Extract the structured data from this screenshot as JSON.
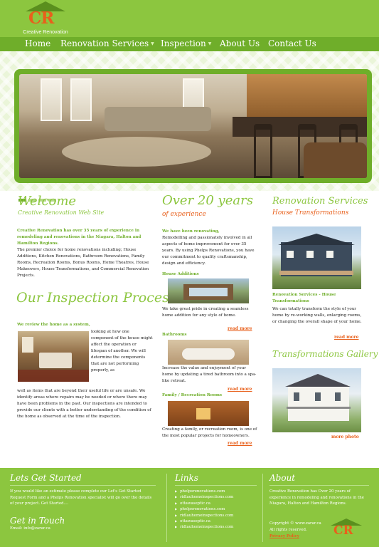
{
  "logo": {
    "letters": "CR",
    "tagline": "Creative Renovation"
  },
  "nav": [
    {
      "label": "Home",
      "has_dropdown": false
    },
    {
      "label": "Renovation Services",
      "has_dropdown": true
    },
    {
      "label": "Inspection",
      "has_dropdown": true
    },
    {
      "label": "About Us",
      "has_dropdown": false
    },
    {
      "label": "Contact Us",
      "has_dropdown": false
    }
  ],
  "welcome": {
    "title": "Welcome",
    "subtitle": "Creative Renovation Web Site",
    "intro": "Creative Renovation has over 35 years of experience in remodeling and renovations in the Niagara, Halton and Hamilton Regions.",
    "body": "The premier choice for home renovations including; House Additions, Kitchen Renovations, Bathroom Renovations, Family Rooms, Recreation Rooms, Bonus Rooms, Home Theatres, House Makeovers, House Transformations, and Commercial Renovation Projects."
  },
  "inspection": {
    "title": "Our Inspection Process",
    "lead": "We review the home as a system,",
    "wrap_text": "looking at how one component of the house might affect the operation or lifespan of another. We will determine the components that are not performing properly, as",
    "body": "well as items that are beyond their useful life or are unsafe. We identify areas where repairs may be needed or where there may have been problems in the past. Our inspections are intended to provide our clients with a better understanding of the condition of the home as observed at the time of the inspection."
  },
  "experience": {
    "title": "Over 20 years",
    "subtitle": "of experience",
    "lead": "We have been renovating,",
    "body": "Remodelling and passionately involved in all aspects of home improvement for over 35 years. By using Phelps Renovations, you have our commitment to quality craftsmanship, design and efficiency.",
    "sections": [
      {
        "heading": "House Additions",
        "text": "We take great pride in creating a seamless home addition for any style of home.",
        "more": "read more"
      },
      {
        "heading": "Bathrooms",
        "text": "Increase the value and enjoyment of your home by updating a tired bathroom into a spa-like retreat.",
        "more": "read more"
      },
      {
        "heading": "Family / Recreation Rooms",
        "text": "Creating a family, or recreation room, is one of the most popular projects for homeowners.",
        "more": "read more"
      }
    ]
  },
  "services": {
    "title": "Renovation Services",
    "subtitle": "House Transformations",
    "heading": "Renovation Services - House Transformations",
    "text": "We can totally transform the style of your home by re-working walls, enlarging rooms, or changing the overall shape of your home.",
    "more": "read more",
    "gallery_title": "Transformations Gallery",
    "gallery_more": "more photo"
  },
  "footer": {
    "start_title": "Lets Get Started",
    "start_text": "If you would like an estimate please complete our Let's Get Started Request Form and a Phelps Renovation specialist will go over the details of your project. Get Started....",
    "touch_title": "Get in Touch",
    "email": "Email: info@zarar.ca",
    "links_title": "Links",
    "links": [
      "phelpsrenovations.com",
      "ridlauhomeinspections.com",
      "ottawaseptic.ca",
      "phelpsrenovations.com",
      "ridlauhomeinspections.com",
      "ottawaseptic.ca",
      "ridlauhomeinspections.com"
    ],
    "about_title": "About",
    "about_text": "Creative Renovation has Over 20 years of experience in remodeling and renovations in the Niagara, Halton and Hamilton Regions.",
    "copyright": "Copyright © www.zarar.ca",
    "rights": "All rights reserved.",
    "privacy": "Privacy Policy"
  },
  "colors": {
    "green": "#8cc63f",
    "dark_green": "#6fae2a",
    "orange": "#e8601c"
  }
}
